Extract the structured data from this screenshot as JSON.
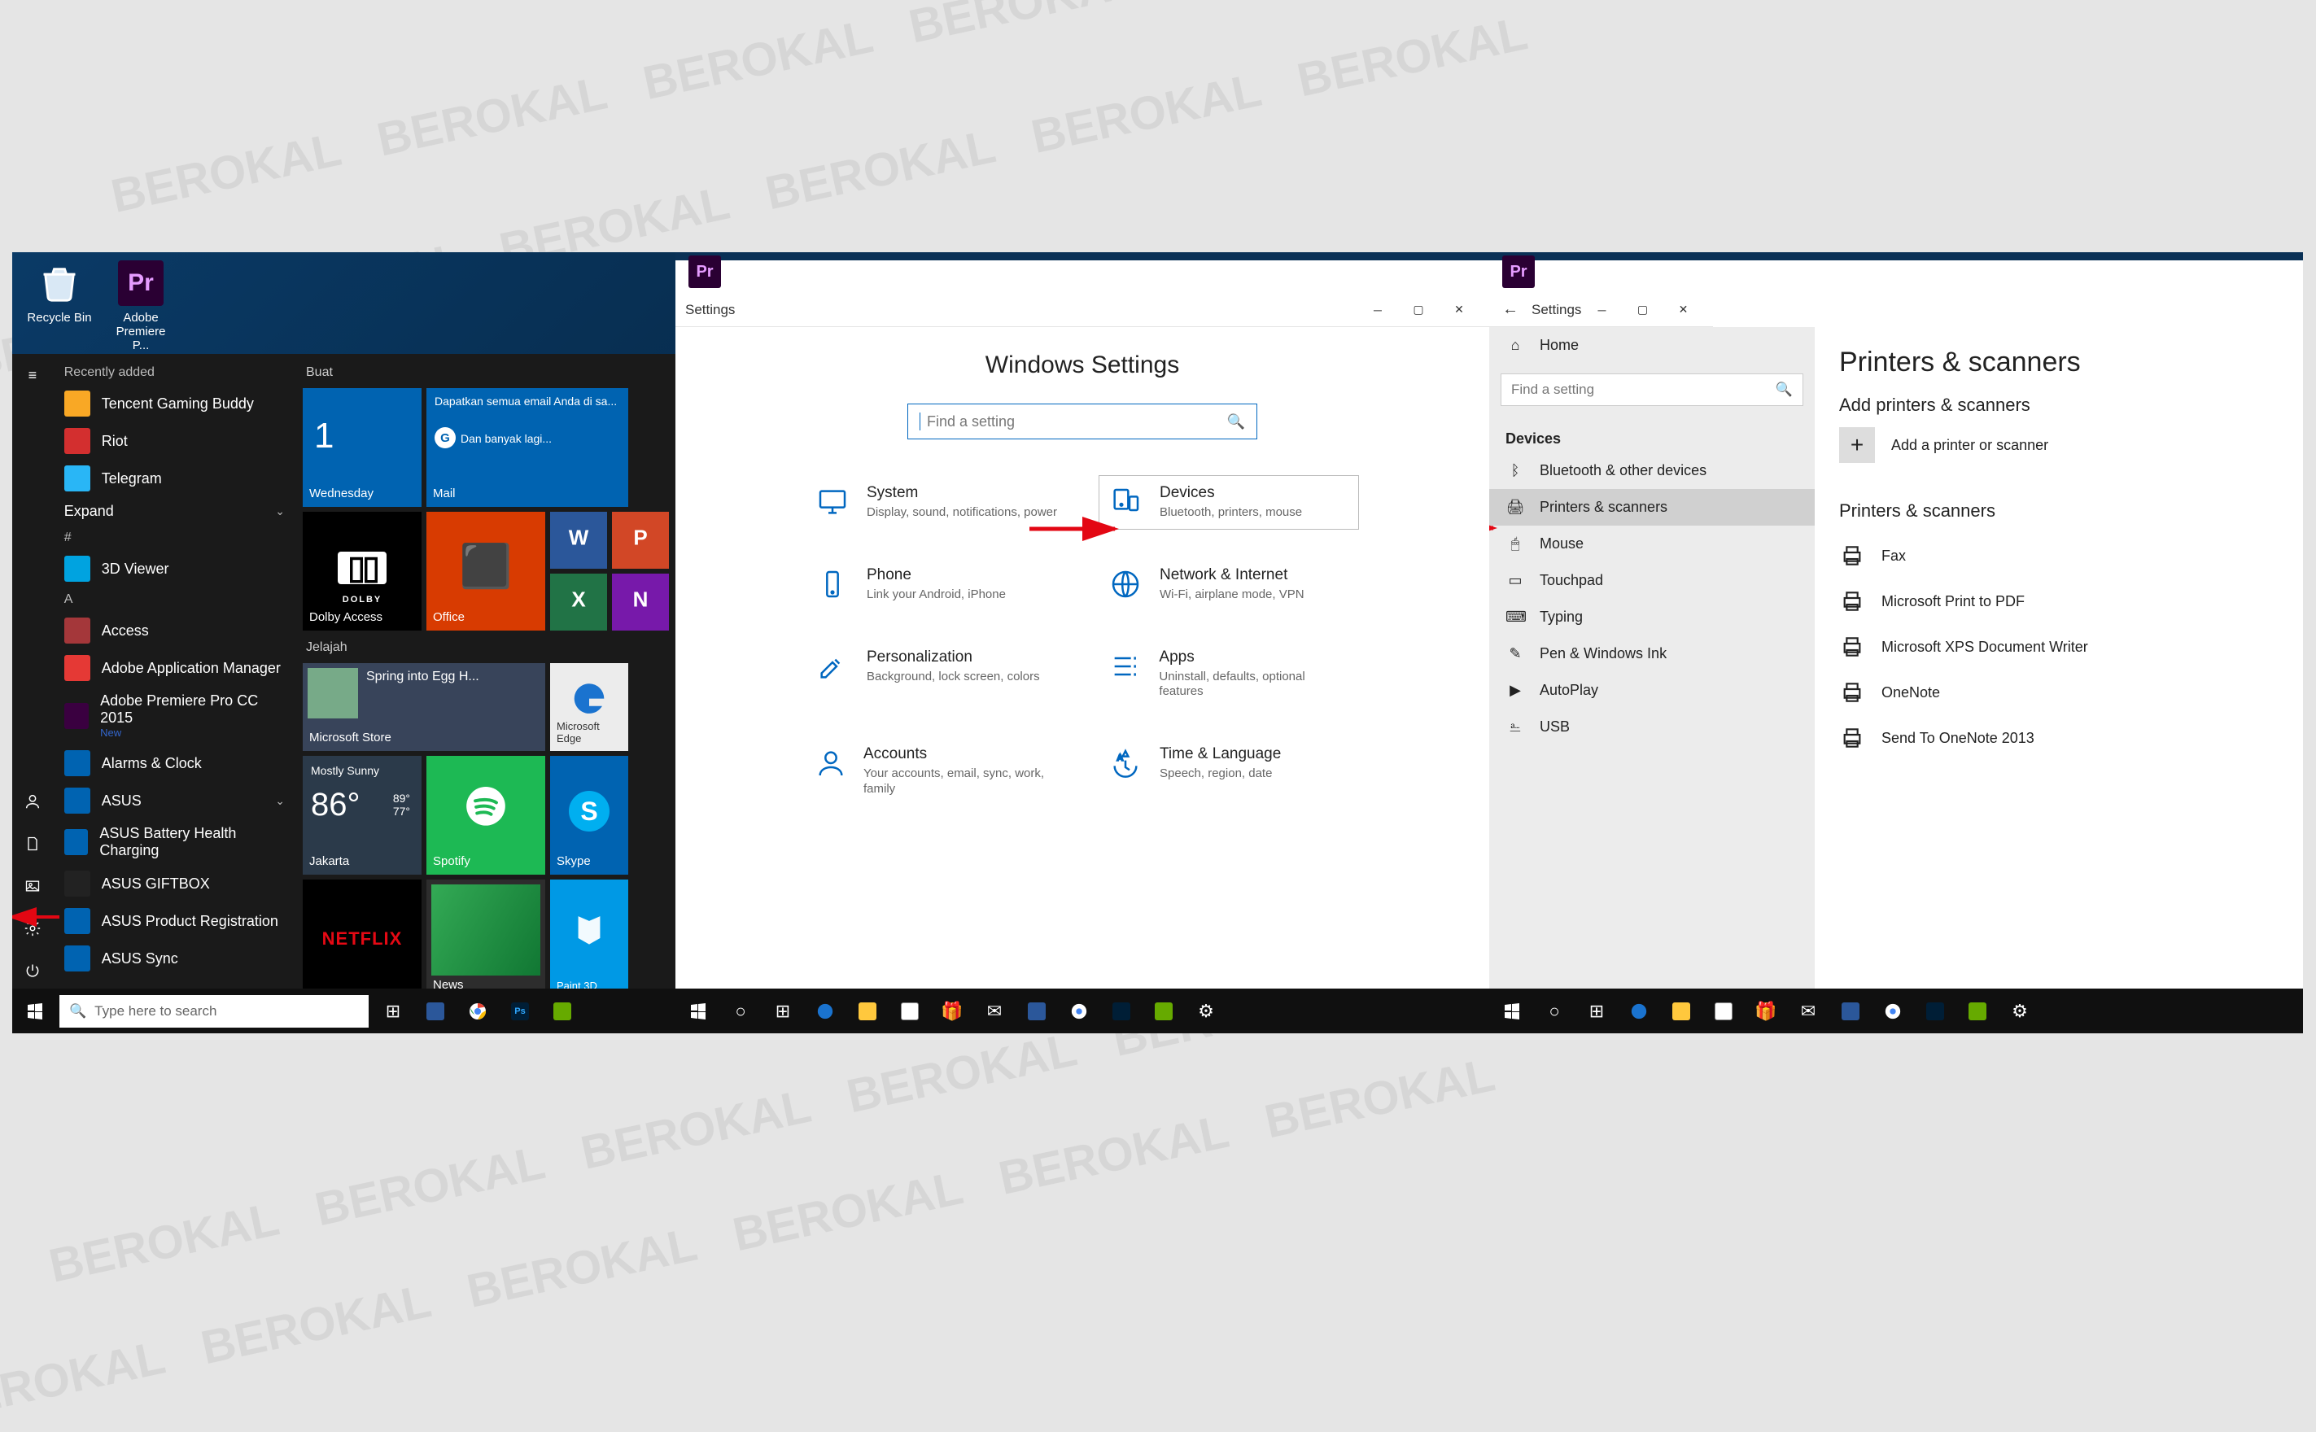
{
  "watermark_word": "BEROKAL",
  "panel1": {
    "desktop_icons": [
      {
        "name": "recycle-bin",
        "label": "Recycle Bin"
      },
      {
        "name": "premiere-shortcut",
        "label": "Adobe Premiere P..."
      }
    ],
    "recently_added_hdr": "Recently added",
    "recent": [
      {
        "label": "Tencent Gaming Buddy",
        "color": "#F9A825"
      },
      {
        "label": "Riot",
        "color": "#D32F2F"
      },
      {
        "label": "Telegram",
        "color": "#29B6F6"
      }
    ],
    "expand_label": "Expand",
    "groups": [
      {
        "letter": "#",
        "items": [
          {
            "label": "3D Viewer",
            "color": "#00A3E0"
          }
        ]
      },
      {
        "letter": "A",
        "items": [
          {
            "label": "Access",
            "color": "#A4373A"
          },
          {
            "label": "Adobe Application Manager",
            "color": "#E53935"
          },
          {
            "label": "Adobe Premiere Pro CC 2015",
            "sub": "New",
            "color": "#3A0040"
          },
          {
            "label": "Alarms & Clock",
            "color": "#0063B1"
          },
          {
            "label": "ASUS",
            "chev": true,
            "color": "#0063B1"
          },
          {
            "label": "ASUS Battery Health Charging",
            "color": "#0063B1"
          },
          {
            "label": "ASUS GIFTBOX",
            "color": "#222"
          },
          {
            "label": "ASUS Product Registration",
            "color": "#0063B1"
          },
          {
            "label": "ASUS Sync",
            "color": "#0063B1"
          }
        ]
      }
    ],
    "tile_groups": {
      "buat": "Buat",
      "jelajah": "Jelajah",
      "calendar_day": "Wednesday",
      "calendar_num": "1",
      "mail_banner": "Dapatkan semua email Anda di sa...",
      "mail_sub": "Dan banyak lagi...",
      "mail_name": "Mail",
      "dolby": "Dolby Access",
      "office": "Office",
      "word": "W",
      "ppt": "P",
      "excel": "X",
      "onenote": "N",
      "store_banner": "Spring into Egg H...",
      "store": "Microsoft Store",
      "edge": "Microsoft Edge",
      "weather_cond": "Mostly Sunny",
      "weather_temp": "86°",
      "weather_hi": "89°",
      "weather_lo": "77°",
      "weather_city": "Jakarta",
      "spotify": "Spotify",
      "skype": "Skype",
      "netflix": "NETFLIX",
      "news": "News",
      "paint3d": "Paint 3D"
    },
    "taskbar": {
      "search_placeholder": "Type here to search"
    }
  },
  "panel2": {
    "pr": "Pr",
    "title": "Settings",
    "heading": "Windows Settings",
    "search_placeholder": "Find a setting",
    "cards": [
      {
        "key": "system",
        "title": "System",
        "desc": "Display, sound, notifications, power"
      },
      {
        "key": "devices",
        "title": "Devices",
        "desc": "Bluetooth, printers, mouse",
        "boxed": true
      },
      {
        "key": "phone",
        "title": "Phone",
        "desc": "Link your Android, iPhone"
      },
      {
        "key": "network",
        "title": "Network & Internet",
        "desc": "Wi-Fi, airplane mode, VPN"
      },
      {
        "key": "personalization",
        "title": "Personalization",
        "desc": "Background, lock screen, colors"
      },
      {
        "key": "apps",
        "title": "Apps",
        "desc": "Uninstall, defaults, optional features"
      },
      {
        "key": "accounts",
        "title": "Accounts",
        "desc": "Your accounts, email, sync, work, family"
      },
      {
        "key": "time",
        "title": "Time & Language",
        "desc": "Speech, region, date"
      }
    ]
  },
  "panel3": {
    "pr": "Pr",
    "title": "Settings",
    "home": "Home",
    "search_placeholder": "Find a setting",
    "section": "Devices",
    "sidebar": [
      {
        "key": "bluetooth",
        "label": "Bluetooth & other devices"
      },
      {
        "key": "printers",
        "label": "Printers & scanners",
        "selected": true
      },
      {
        "key": "mouse",
        "label": "Mouse"
      },
      {
        "key": "touchpad",
        "label": "Touchpad"
      },
      {
        "key": "typing",
        "label": "Typing"
      },
      {
        "key": "pen",
        "label": "Pen & Windows Ink"
      },
      {
        "key": "autoplay",
        "label": "AutoPlay"
      },
      {
        "key": "usb",
        "label": "USB"
      }
    ],
    "main_heading": "Printers & scanners",
    "add_section": "Add printers & scanners",
    "add_button": "Add a printer or scanner",
    "list_section": "Printers & scanners",
    "printers": [
      "Fax",
      "Microsoft Print to PDF",
      "Microsoft XPS Document Writer",
      "OneNote",
      "Send To OneNote 2013"
    ]
  }
}
